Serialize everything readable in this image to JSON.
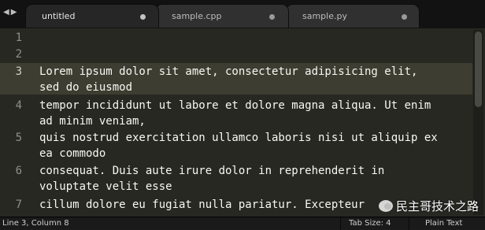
{
  "tabs": [
    {
      "label": "untitled",
      "active": true
    },
    {
      "label": "sample.cpp",
      "active": false
    },
    {
      "label": "sample.py",
      "active": false
    }
  ],
  "nav": {
    "back_icon": "◀",
    "forward_icon": "▶"
  },
  "gutter": {
    "line_numbers": [
      "1",
      "2",
      "3",
      "4",
      "5",
      "6",
      "7"
    ],
    "current_line": "3"
  },
  "code_lines": [
    "Lorem ipsum dolor sit amet, consectetur adipisicing elit,",
    "sed do eiusmod",
    "tempor incididunt ut labore et dolore magna aliqua. Ut enim",
    "ad minim veniam,",
    "quis nostrud exercitation ullamco laboris nisi ut aliquip ex",
    "ea commodo",
    "consequat. Duis aute irure dolor in reprehenderit in",
    "voluptate velit esse",
    "cillum dolore eu fugiat nulla pariatur. Excepteur"
  ],
  "status": {
    "position": "Line 3, Column 8",
    "tab_size": "Tab Size: 4",
    "syntax": "Plain Text"
  },
  "watermark": {
    "text": "民主哥技术之路"
  },
  "colors": {
    "editor_bg": "#272822",
    "current_line": "#3e3d32",
    "text": "#f8f8f2"
  }
}
